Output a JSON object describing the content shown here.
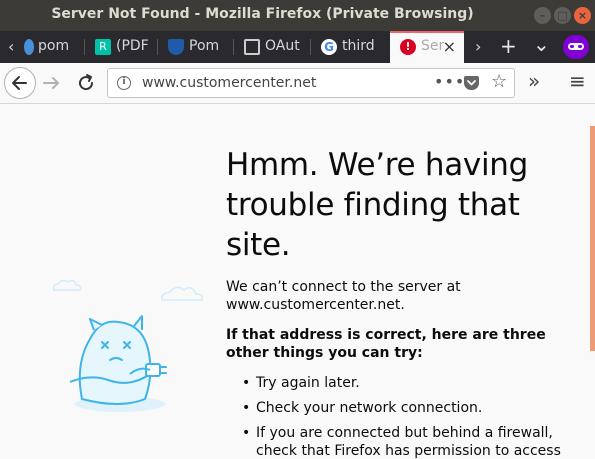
{
  "window": {
    "title": "Server Not Found - Mozilla Firefox (Private Browsing)",
    "minimize_glyph": "–",
    "maximize_glyph": "□",
    "close_glyph": "×"
  },
  "tabs": [
    {
      "label": "pom",
      "favicon": "chrome-icon",
      "color": "#4a90d9"
    },
    {
      "label": "(PDF",
      "favicon": "researchgate-icon",
      "color": "#00c2a8"
    },
    {
      "label": "Pom",
      "favicon": "shield-icon",
      "color": "#1e5ba8"
    },
    {
      "label": "OAut",
      "favicon": "book-icon",
      "color": "#cfcfcf"
    },
    {
      "label": "third",
      "favicon": "google-icon",
      "color": "#4285f4"
    },
    {
      "label": "Ser",
      "favicon": "error-icon",
      "color": "#d70022",
      "active": true,
      "close": "×"
    }
  ],
  "tabstrip": {
    "scroll_left": "‹",
    "scroll_right": "›",
    "new_tab": "+",
    "list_all": "⌄"
  },
  "navbar": {
    "url": "www.customercenter.net",
    "info_glyph": "i",
    "page_actions": "•••",
    "star": "☆",
    "overflow": "»",
    "menu": "≡"
  },
  "error_page": {
    "heading": "Hmm. We’re having trouble finding that site.",
    "description": "We can’t connect to the server at www.customercenter.net.",
    "subhead": "If that address is correct, here are three other things you can try:",
    "tips": [
      "Try again later.",
      "Check your network connection.",
      "If you are connected but behind a firewall, check that Firefox has permission to access"
    ]
  },
  "colors": {
    "accent": "#ed9b77",
    "titlebar": "#3c3b37",
    "tabstrip": "#2a2a2e",
    "private_badge": "#8000d7"
  }
}
